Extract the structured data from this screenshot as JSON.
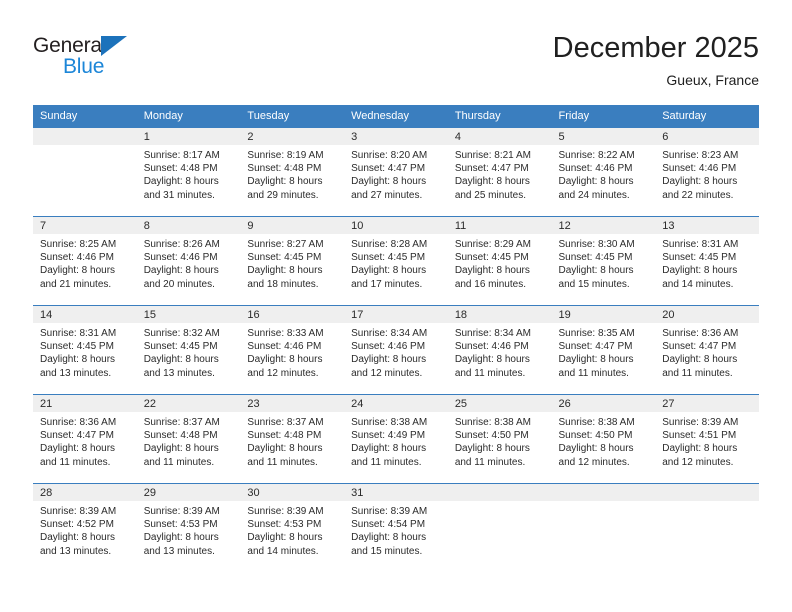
{
  "brand": {
    "name_top": "General",
    "name_bottom": "Blue",
    "triangle_color": "#1c72bb",
    "blue_color": "#1c86d8"
  },
  "header": {
    "title": "December 2025",
    "subtitle": "Gueux, France"
  },
  "theme": {
    "header_bg": "#3a7ebf",
    "daynum_bg": "#efefef",
    "text_color": "#2b2b2b"
  },
  "calendar": {
    "weekday_headers": [
      "Sunday",
      "Monday",
      "Tuesday",
      "Wednesday",
      "Thursday",
      "Friday",
      "Saturday"
    ],
    "weeks": [
      [
        {
          "day": "",
          "sunrise": "",
          "sunset": "",
          "daylight": ""
        },
        {
          "day": "1",
          "sunrise": "Sunrise: 8:17 AM",
          "sunset": "Sunset: 4:48 PM",
          "daylight": "Daylight: 8 hours and 31 minutes."
        },
        {
          "day": "2",
          "sunrise": "Sunrise: 8:19 AM",
          "sunset": "Sunset: 4:48 PM",
          "daylight": "Daylight: 8 hours and 29 minutes."
        },
        {
          "day": "3",
          "sunrise": "Sunrise: 8:20 AM",
          "sunset": "Sunset: 4:47 PM",
          "daylight": "Daylight: 8 hours and 27 minutes."
        },
        {
          "day": "4",
          "sunrise": "Sunrise: 8:21 AM",
          "sunset": "Sunset: 4:47 PM",
          "daylight": "Daylight: 8 hours and 25 minutes."
        },
        {
          "day": "5",
          "sunrise": "Sunrise: 8:22 AM",
          "sunset": "Sunset: 4:46 PM",
          "daylight": "Daylight: 8 hours and 24 minutes."
        },
        {
          "day": "6",
          "sunrise": "Sunrise: 8:23 AM",
          "sunset": "Sunset: 4:46 PM",
          "daylight": "Daylight: 8 hours and 22 minutes."
        }
      ],
      [
        {
          "day": "7",
          "sunrise": "Sunrise: 8:25 AM",
          "sunset": "Sunset: 4:46 PM",
          "daylight": "Daylight: 8 hours and 21 minutes."
        },
        {
          "day": "8",
          "sunrise": "Sunrise: 8:26 AM",
          "sunset": "Sunset: 4:46 PM",
          "daylight": "Daylight: 8 hours and 20 minutes."
        },
        {
          "day": "9",
          "sunrise": "Sunrise: 8:27 AM",
          "sunset": "Sunset: 4:45 PM",
          "daylight": "Daylight: 8 hours and 18 minutes."
        },
        {
          "day": "10",
          "sunrise": "Sunrise: 8:28 AM",
          "sunset": "Sunset: 4:45 PM",
          "daylight": "Daylight: 8 hours and 17 minutes."
        },
        {
          "day": "11",
          "sunrise": "Sunrise: 8:29 AM",
          "sunset": "Sunset: 4:45 PM",
          "daylight": "Daylight: 8 hours and 16 minutes."
        },
        {
          "day": "12",
          "sunrise": "Sunrise: 8:30 AM",
          "sunset": "Sunset: 4:45 PM",
          "daylight": "Daylight: 8 hours and 15 minutes."
        },
        {
          "day": "13",
          "sunrise": "Sunrise: 8:31 AM",
          "sunset": "Sunset: 4:45 PM",
          "daylight": "Daylight: 8 hours and 14 minutes."
        }
      ],
      [
        {
          "day": "14",
          "sunrise": "Sunrise: 8:31 AM",
          "sunset": "Sunset: 4:45 PM",
          "daylight": "Daylight: 8 hours and 13 minutes."
        },
        {
          "day": "15",
          "sunrise": "Sunrise: 8:32 AM",
          "sunset": "Sunset: 4:45 PM",
          "daylight": "Daylight: 8 hours and 13 minutes."
        },
        {
          "day": "16",
          "sunrise": "Sunrise: 8:33 AM",
          "sunset": "Sunset: 4:46 PM",
          "daylight": "Daylight: 8 hours and 12 minutes."
        },
        {
          "day": "17",
          "sunrise": "Sunrise: 8:34 AM",
          "sunset": "Sunset: 4:46 PM",
          "daylight": "Daylight: 8 hours and 12 minutes."
        },
        {
          "day": "18",
          "sunrise": "Sunrise: 8:34 AM",
          "sunset": "Sunset: 4:46 PM",
          "daylight": "Daylight: 8 hours and 11 minutes."
        },
        {
          "day": "19",
          "sunrise": "Sunrise: 8:35 AM",
          "sunset": "Sunset: 4:47 PM",
          "daylight": "Daylight: 8 hours and 11 minutes."
        },
        {
          "day": "20",
          "sunrise": "Sunrise: 8:36 AM",
          "sunset": "Sunset: 4:47 PM",
          "daylight": "Daylight: 8 hours and 11 minutes."
        }
      ],
      [
        {
          "day": "21",
          "sunrise": "Sunrise: 8:36 AM",
          "sunset": "Sunset: 4:47 PM",
          "daylight": "Daylight: 8 hours and 11 minutes."
        },
        {
          "day": "22",
          "sunrise": "Sunrise: 8:37 AM",
          "sunset": "Sunset: 4:48 PM",
          "daylight": "Daylight: 8 hours and 11 minutes."
        },
        {
          "day": "23",
          "sunrise": "Sunrise: 8:37 AM",
          "sunset": "Sunset: 4:48 PM",
          "daylight": "Daylight: 8 hours and 11 minutes."
        },
        {
          "day": "24",
          "sunrise": "Sunrise: 8:38 AM",
          "sunset": "Sunset: 4:49 PM",
          "daylight": "Daylight: 8 hours and 11 minutes."
        },
        {
          "day": "25",
          "sunrise": "Sunrise: 8:38 AM",
          "sunset": "Sunset: 4:50 PM",
          "daylight": "Daylight: 8 hours and 11 minutes."
        },
        {
          "day": "26",
          "sunrise": "Sunrise: 8:38 AM",
          "sunset": "Sunset: 4:50 PM",
          "daylight": "Daylight: 8 hours and 12 minutes."
        },
        {
          "day": "27",
          "sunrise": "Sunrise: 8:39 AM",
          "sunset": "Sunset: 4:51 PM",
          "daylight": "Daylight: 8 hours and 12 minutes."
        }
      ],
      [
        {
          "day": "28",
          "sunrise": "Sunrise: 8:39 AM",
          "sunset": "Sunset: 4:52 PM",
          "daylight": "Daylight: 8 hours and 13 minutes."
        },
        {
          "day": "29",
          "sunrise": "Sunrise: 8:39 AM",
          "sunset": "Sunset: 4:53 PM",
          "daylight": "Daylight: 8 hours and 13 minutes."
        },
        {
          "day": "30",
          "sunrise": "Sunrise: 8:39 AM",
          "sunset": "Sunset: 4:53 PM",
          "daylight": "Daylight: 8 hours and 14 minutes."
        },
        {
          "day": "31",
          "sunrise": "Sunrise: 8:39 AM",
          "sunset": "Sunset: 4:54 PM",
          "daylight": "Daylight: 8 hours and 15 minutes."
        },
        {
          "day": "",
          "sunrise": "",
          "sunset": "",
          "daylight": ""
        },
        {
          "day": "",
          "sunrise": "",
          "sunset": "",
          "daylight": ""
        },
        {
          "day": "",
          "sunrise": "",
          "sunset": "",
          "daylight": ""
        }
      ]
    ]
  }
}
